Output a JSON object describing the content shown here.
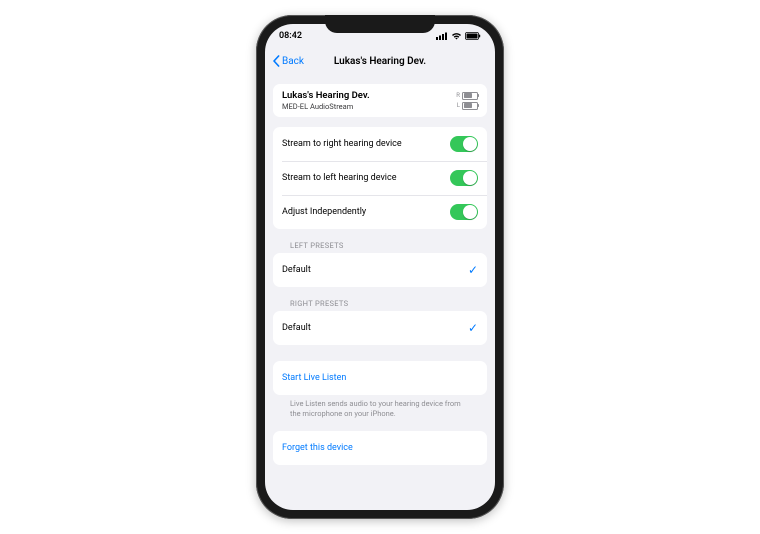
{
  "status": {
    "time": "08:42",
    "right_battery_pct": 70,
    "left_battery_pct": 60
  },
  "nav": {
    "back": "Back",
    "title": "Lukas's Hearing Dev."
  },
  "device": {
    "name": "Lukas's Hearing Dev.",
    "model": "MED-EL AudioStream",
    "r_label": "R",
    "l_label": "L"
  },
  "toggles": {
    "stream_right": {
      "label": "Stream to right hearing device",
      "on": true
    },
    "stream_left": {
      "label": "Stream to left hearing device",
      "on": true
    },
    "adjust_independently": {
      "label": "Adjust Independently",
      "on": true
    }
  },
  "left_presets": {
    "header": "LEFT PRESETS",
    "option": "Default",
    "selected": true
  },
  "right_presets": {
    "header": "RIGHT PRESETS",
    "option": "Default",
    "selected": true
  },
  "live_listen": {
    "action": "Start Live Listen",
    "footer": "Live Listen sends audio to your hearing device from the microphone on your iPhone."
  },
  "forget": {
    "action": "Forget this device"
  }
}
